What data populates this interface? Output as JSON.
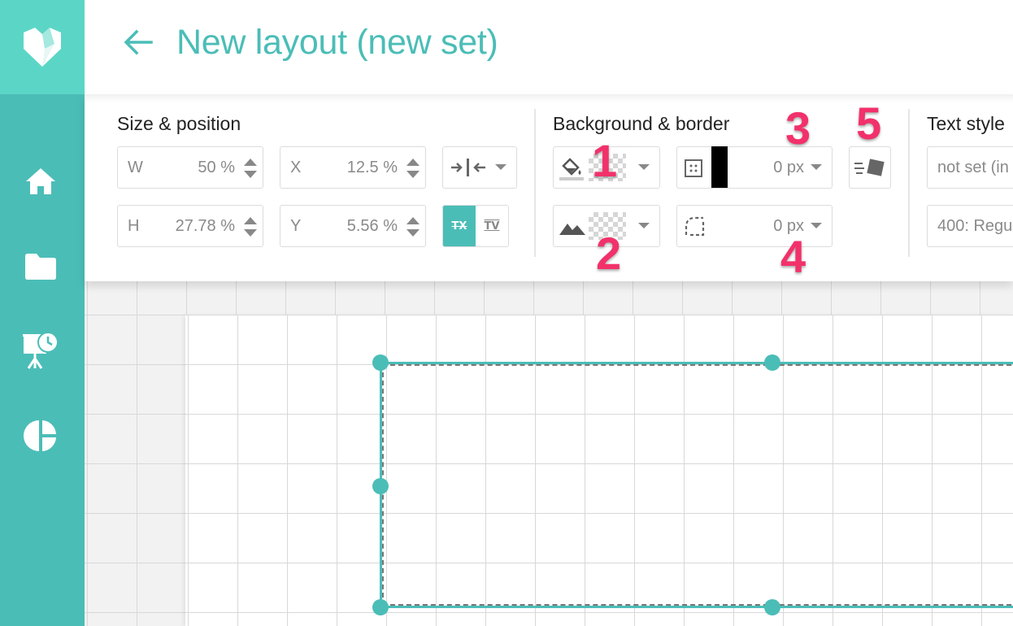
{
  "header": {
    "title": "New layout (new set)"
  },
  "sidebar": {
    "items": [
      {
        "icon": "home-icon"
      },
      {
        "icon": "folder-icon"
      },
      {
        "icon": "presentation-schedule-icon"
      },
      {
        "icon": "pie-chart-icon"
      }
    ]
  },
  "toolbar": {
    "size_position": {
      "title": "Size & position",
      "width": {
        "label": "W",
        "value": "50 %"
      },
      "height": {
        "label": "H",
        "value": "27.78 %"
      },
      "x": {
        "label": "X",
        "value": "12.5 %"
      },
      "y": {
        "label": "Y",
        "value": "5.56 %"
      },
      "transform_toggles": [
        "TX",
        "TV"
      ]
    },
    "background_border": {
      "title": "Background & border",
      "border_width": "0 px",
      "border_radius": "0 px",
      "border_color": "#000000"
    },
    "text_style": {
      "title": "Text style",
      "font_family": "not set (in",
      "font_weight": "400: Regu"
    }
  },
  "callouts": [
    "1",
    "2",
    "3",
    "4",
    "5"
  ],
  "colors": {
    "accent": "#4bbdb7",
    "logo_bg": "#5bd6c6",
    "callout": "#f2316b"
  }
}
